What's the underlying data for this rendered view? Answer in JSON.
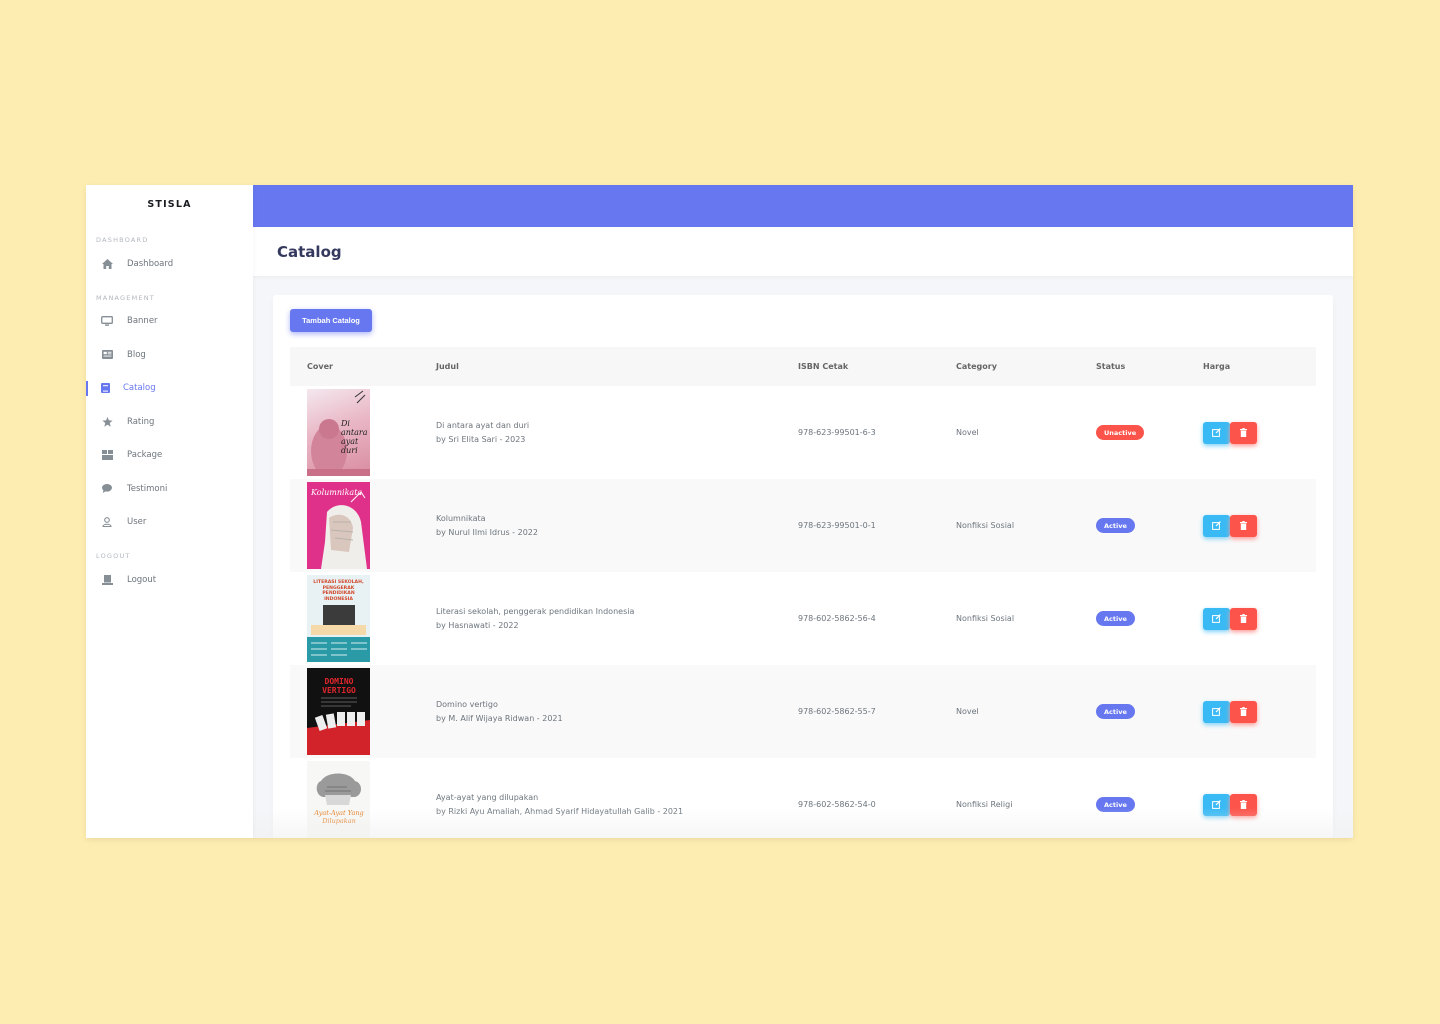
{
  "brand": "STISLA",
  "sidebar": {
    "headers": {
      "dashboard": "DASHBOARD",
      "management": "MANAGEMENT",
      "logout": "LOGOUT"
    },
    "items": [
      {
        "label": "Dashboard",
        "icon": "home-icon"
      },
      {
        "label": "Banner",
        "icon": "monitor-icon"
      },
      {
        "label": "Blog",
        "icon": "newspaper-icon"
      },
      {
        "label": "Catalog",
        "icon": "book-icon",
        "active": true
      },
      {
        "label": "Rating",
        "icon": "star-icon"
      },
      {
        "label": "Package",
        "icon": "box-icon"
      },
      {
        "label": "Testimoni",
        "icon": "comment-icon"
      },
      {
        "label": "User",
        "icon": "user-icon"
      },
      {
        "label": "Logout",
        "icon": "logout-icon"
      }
    ]
  },
  "page": {
    "title": "Catalog",
    "add_button": "Tambah Catalog"
  },
  "table": {
    "headers": [
      "Cover",
      "Judul",
      "ISBN Cetak",
      "Category",
      "Status",
      "Harga"
    ],
    "rows": [
      {
        "title": "Di antara ayat dan duri",
        "byline": "by Sri Elita Sari - 2023",
        "isbn": "978-623-99501-6-3",
        "category": "Novel",
        "status": "Unactive",
        "status_color": "#fc544b",
        "cover_title": "Di antara ayat duri"
      },
      {
        "title": "Kolumnikata",
        "byline": "by Nurul Ilmi Idrus - 2022",
        "isbn": "978-623-99501-0-1",
        "category": "Nonfiksi Sosial",
        "status": "Active",
        "status_color": "#6777ef",
        "cover_title": "Kolumnikata"
      },
      {
        "title": "Literasi sekolah, penggerak pendidikan Indonesia",
        "byline": "by Hasnawati - 2022",
        "isbn": "978-602-5862-56-4",
        "category": "Nonfiksi Sosial",
        "status": "Active",
        "status_color": "#6777ef",
        "cover_title": "LITERASI SEKOLAH, PENGGERAK PENDIDIKAN INDONESIA"
      },
      {
        "title": "Domino vertigo",
        "byline": "by M. Alif Wijaya Ridwan - 2021",
        "isbn": "978-602-5862-55-7",
        "category": "Novel",
        "status": "Active",
        "status_color": "#6777ef",
        "cover_title": "DOMINO VERTIGO"
      },
      {
        "title": "Ayat-ayat yang dilupakan",
        "byline": "by Rizki Ayu Amaliah, Ahmad Syarif Hidayatullah Galib - 2021",
        "isbn": "978-602-5862-54-0",
        "category": "Nonfiksi Religi",
        "status": "Active",
        "status_color": "#6777ef",
        "cover_title": "Ayat-Ayat Yang Dilupakan"
      }
    ]
  },
  "colors": {
    "primary": "#6777ef",
    "danger": "#fc544b",
    "info": "#3abaf4",
    "background": "#FEEDB0"
  }
}
